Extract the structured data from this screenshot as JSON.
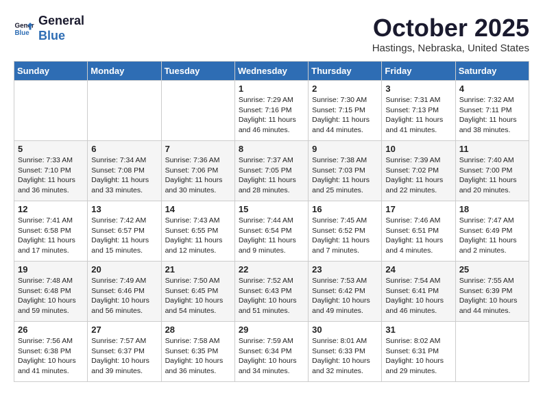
{
  "header": {
    "logo_line1": "General",
    "logo_line2": "Blue",
    "month": "October 2025",
    "location": "Hastings, Nebraska, United States"
  },
  "days_of_week": [
    "Sunday",
    "Monday",
    "Tuesday",
    "Wednesday",
    "Thursday",
    "Friday",
    "Saturday"
  ],
  "weeks": [
    [
      {
        "day": "",
        "info": ""
      },
      {
        "day": "",
        "info": ""
      },
      {
        "day": "",
        "info": ""
      },
      {
        "day": "1",
        "info": "Sunrise: 7:29 AM\nSunset: 7:16 PM\nDaylight: 11 hours\nand 46 minutes."
      },
      {
        "day": "2",
        "info": "Sunrise: 7:30 AM\nSunset: 7:15 PM\nDaylight: 11 hours\nand 44 minutes."
      },
      {
        "day": "3",
        "info": "Sunrise: 7:31 AM\nSunset: 7:13 PM\nDaylight: 11 hours\nand 41 minutes."
      },
      {
        "day": "4",
        "info": "Sunrise: 7:32 AM\nSunset: 7:11 PM\nDaylight: 11 hours\nand 38 minutes."
      }
    ],
    [
      {
        "day": "5",
        "info": "Sunrise: 7:33 AM\nSunset: 7:10 PM\nDaylight: 11 hours\nand 36 minutes."
      },
      {
        "day": "6",
        "info": "Sunrise: 7:34 AM\nSunset: 7:08 PM\nDaylight: 11 hours\nand 33 minutes."
      },
      {
        "day": "7",
        "info": "Sunrise: 7:36 AM\nSunset: 7:06 PM\nDaylight: 11 hours\nand 30 minutes."
      },
      {
        "day": "8",
        "info": "Sunrise: 7:37 AM\nSunset: 7:05 PM\nDaylight: 11 hours\nand 28 minutes."
      },
      {
        "day": "9",
        "info": "Sunrise: 7:38 AM\nSunset: 7:03 PM\nDaylight: 11 hours\nand 25 minutes."
      },
      {
        "day": "10",
        "info": "Sunrise: 7:39 AM\nSunset: 7:02 PM\nDaylight: 11 hours\nand 22 minutes."
      },
      {
        "day": "11",
        "info": "Sunrise: 7:40 AM\nSunset: 7:00 PM\nDaylight: 11 hours\nand 20 minutes."
      }
    ],
    [
      {
        "day": "12",
        "info": "Sunrise: 7:41 AM\nSunset: 6:58 PM\nDaylight: 11 hours\nand 17 minutes."
      },
      {
        "day": "13",
        "info": "Sunrise: 7:42 AM\nSunset: 6:57 PM\nDaylight: 11 hours\nand 15 minutes."
      },
      {
        "day": "14",
        "info": "Sunrise: 7:43 AM\nSunset: 6:55 PM\nDaylight: 11 hours\nand 12 minutes."
      },
      {
        "day": "15",
        "info": "Sunrise: 7:44 AM\nSunset: 6:54 PM\nDaylight: 11 hours\nand 9 minutes."
      },
      {
        "day": "16",
        "info": "Sunrise: 7:45 AM\nSunset: 6:52 PM\nDaylight: 11 hours\nand 7 minutes."
      },
      {
        "day": "17",
        "info": "Sunrise: 7:46 AM\nSunset: 6:51 PM\nDaylight: 11 hours\nand 4 minutes."
      },
      {
        "day": "18",
        "info": "Sunrise: 7:47 AM\nSunset: 6:49 PM\nDaylight: 11 hours\nand 2 minutes."
      }
    ],
    [
      {
        "day": "19",
        "info": "Sunrise: 7:48 AM\nSunset: 6:48 PM\nDaylight: 10 hours\nand 59 minutes."
      },
      {
        "day": "20",
        "info": "Sunrise: 7:49 AM\nSunset: 6:46 PM\nDaylight: 10 hours\nand 56 minutes."
      },
      {
        "day": "21",
        "info": "Sunrise: 7:50 AM\nSunset: 6:45 PM\nDaylight: 10 hours\nand 54 minutes."
      },
      {
        "day": "22",
        "info": "Sunrise: 7:52 AM\nSunset: 6:43 PM\nDaylight: 10 hours\nand 51 minutes."
      },
      {
        "day": "23",
        "info": "Sunrise: 7:53 AM\nSunset: 6:42 PM\nDaylight: 10 hours\nand 49 minutes."
      },
      {
        "day": "24",
        "info": "Sunrise: 7:54 AM\nSunset: 6:41 PM\nDaylight: 10 hours\nand 46 minutes."
      },
      {
        "day": "25",
        "info": "Sunrise: 7:55 AM\nSunset: 6:39 PM\nDaylight: 10 hours\nand 44 minutes."
      }
    ],
    [
      {
        "day": "26",
        "info": "Sunrise: 7:56 AM\nSunset: 6:38 PM\nDaylight: 10 hours\nand 41 minutes."
      },
      {
        "day": "27",
        "info": "Sunrise: 7:57 AM\nSunset: 6:37 PM\nDaylight: 10 hours\nand 39 minutes."
      },
      {
        "day": "28",
        "info": "Sunrise: 7:58 AM\nSunset: 6:35 PM\nDaylight: 10 hours\nand 36 minutes."
      },
      {
        "day": "29",
        "info": "Sunrise: 7:59 AM\nSunset: 6:34 PM\nDaylight: 10 hours\nand 34 minutes."
      },
      {
        "day": "30",
        "info": "Sunrise: 8:01 AM\nSunset: 6:33 PM\nDaylight: 10 hours\nand 32 minutes."
      },
      {
        "day": "31",
        "info": "Sunrise: 8:02 AM\nSunset: 6:31 PM\nDaylight: 10 hours\nand 29 minutes."
      },
      {
        "day": "",
        "info": ""
      }
    ]
  ]
}
